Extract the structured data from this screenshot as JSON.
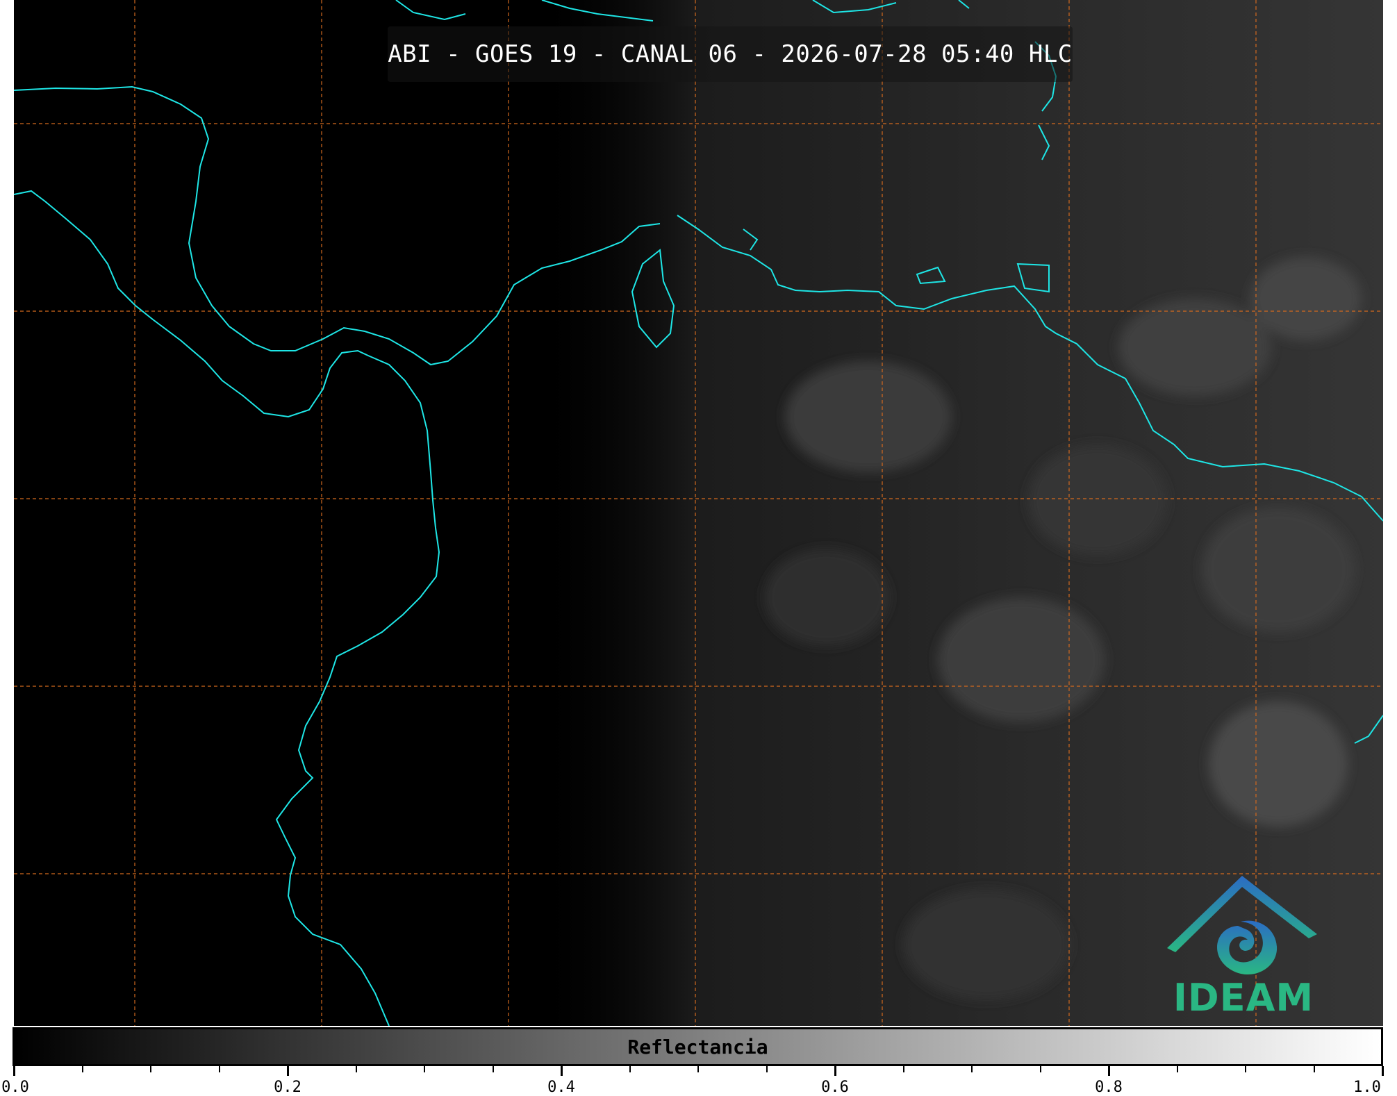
{
  "title": "ABI - GOES 19 - CANAL 06 - 2026-07-28 05:40 HLC",
  "colorbar": {
    "label": "Reflectancia",
    "min": 0.0,
    "max": 1.0,
    "major_ticks": [
      "0.0",
      "0.2",
      "0.4",
      "0.6",
      "0.8",
      "1.0"
    ],
    "minor_step": 0.05,
    "colors": [
      "#000000",
      "#ffffff"
    ]
  },
  "map": {
    "background": "#000000",
    "coastline_color": "#1ee6e6",
    "gridline_color": "#d2691e",
    "gridline_style": "dashed"
  },
  "logo": {
    "text": "IDEAM",
    "colors": [
      "#2b6cc4",
      "#2ab783"
    ]
  }
}
